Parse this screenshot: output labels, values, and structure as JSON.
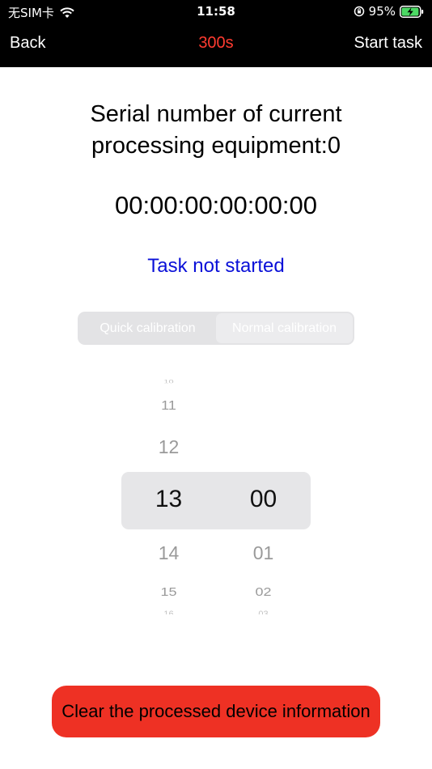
{
  "status_bar": {
    "carrier": "无SIM卡",
    "time": "11:58",
    "battery_percent": "95%",
    "battery_level": 0.95,
    "icons": [
      "wifi-icon",
      "orientation-lock-icon",
      "battery-charging-icon"
    ]
  },
  "nav": {
    "back_label": "Back",
    "title": "300s",
    "start_label": "Start task",
    "title_color": "#ff3b30"
  },
  "main": {
    "serial_title": "Serial number of current processing equipment:0",
    "timer": "00:00:00:00:00:00",
    "task_status": "Task not started",
    "task_status_color": "#0a10d8"
  },
  "calibration": {
    "options": [
      "Quick calibration",
      "Normal calibration"
    ],
    "selected": "Normal calibration"
  },
  "picker": {
    "hours": {
      "selected": "13",
      "visible": [
        "10",
        "11",
        "12",
        "13",
        "14",
        "15",
        "16"
      ]
    },
    "minutes": {
      "selected": "00",
      "visible": [
        "00",
        "01",
        "02",
        "03"
      ]
    }
  },
  "clear_button": {
    "label": "Clear the processed device information",
    "color": "#ee3124"
  }
}
